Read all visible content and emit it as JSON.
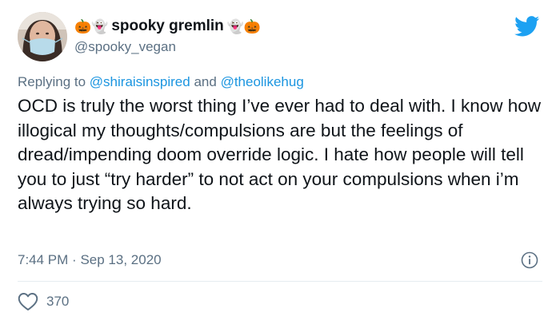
{
  "author": {
    "display_name": "spooky gremlin",
    "emoji_before": "🎃👻",
    "emoji_after": "👻🎃",
    "handle": "@spooky_vegan"
  },
  "reply": {
    "prefix": "Replying to",
    "mention_1": "@shiraisinspired",
    "joiner": "and",
    "mention_2": "@theolikehug"
  },
  "tweet": {
    "text": "OCD is truly the worst thing I’ve ever had to deal with. I know how illogical my thoughts/compulsions are but the feelings of dread/impending doom override logic. I hate how people will tell you to just “try harder” to not act on your compulsions when i’m always trying so hard.",
    "time": "7:44 PM",
    "separator": "·",
    "date": "Sep 13, 2020",
    "like_count": "370"
  },
  "icons": {
    "brand": "twitter-bird-icon",
    "info": "info-icon",
    "like": "heart-icon"
  },
  "colors": {
    "twitter_blue": "#1da1f2",
    "mention": "#1b95e0",
    "secondary_text": "#5b7083",
    "divider": "#e6ecf0"
  }
}
